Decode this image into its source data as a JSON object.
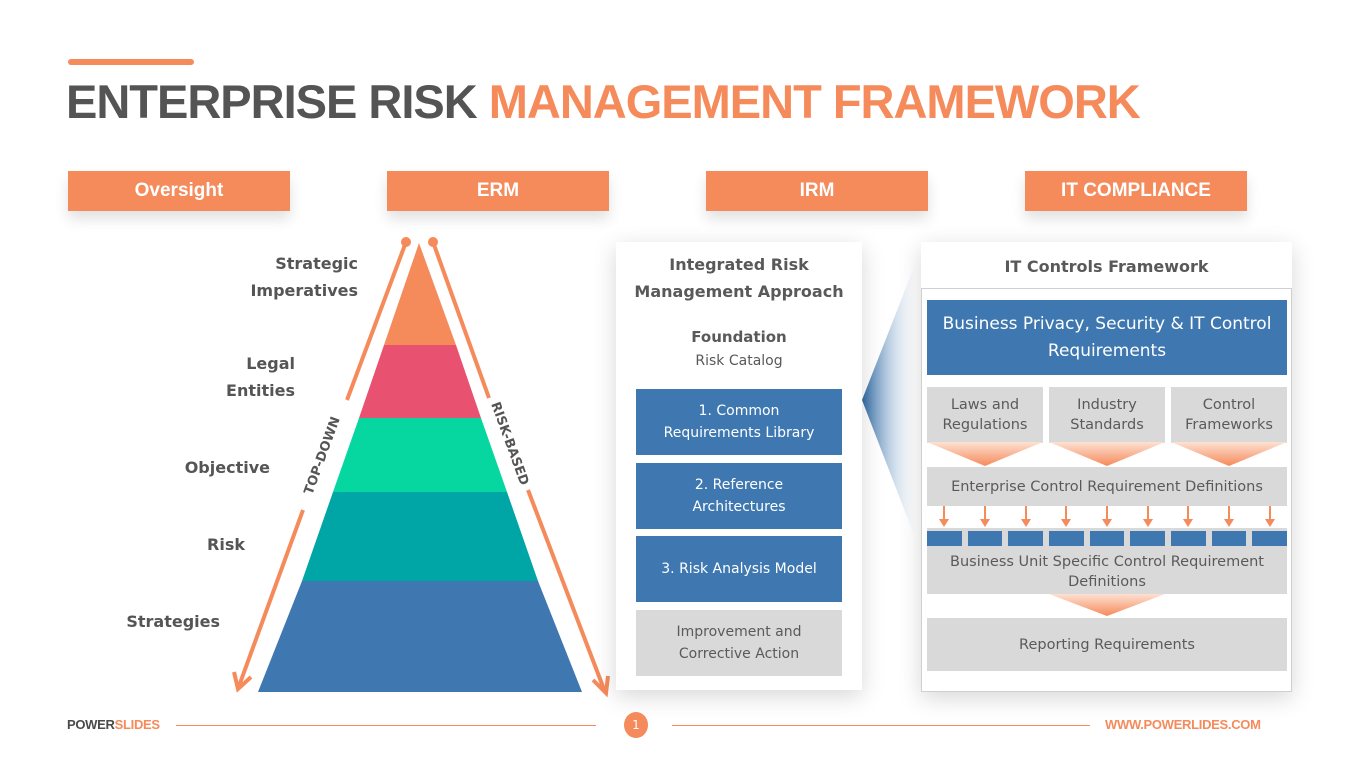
{
  "title": {
    "part1": "ENTERPRISE RISK",
    "part2": "MANAGEMENT FRAMEWORK"
  },
  "categories": [
    "Oversight",
    "ERM",
    "IRM",
    "IT COMPLIANCE"
  ],
  "pyramid": {
    "levels": [
      {
        "label_lines": [
          "Strategic",
          "Imperatives"
        ],
        "color": "#f58a5b"
      },
      {
        "label_lines": [
          "Legal",
          "Entities"
        ],
        "color": "#e85270"
      },
      {
        "label_lines": [
          "Objective"
        ],
        "color": "#06d6a0"
      },
      {
        "label_lines": [
          "Risk"
        ],
        "color": "#00a6a6"
      },
      {
        "label_lines": [
          "Strategies"
        ],
        "color": "#3f78b0"
      }
    ],
    "left_arrow_label": "TOP-DOWN",
    "right_arrow_label": "RISK-BASED",
    "arrow_color": "#f58a5b"
  },
  "irm": {
    "title_line1": "Integrated Risk",
    "title_line2": "Management Approach",
    "foundation": "Foundation",
    "catalog": "Risk Catalog",
    "steps": [
      {
        "line1": "1. Common",
        "line2": "Requirements Library"
      },
      {
        "line1": "2. Reference",
        "line2": "Architectures"
      },
      {
        "line1": "3. Risk Analysis Model",
        "line2": ""
      }
    ],
    "final_line1": "Improvement and",
    "final_line2": "Corrective Action"
  },
  "it": {
    "title": "IT Controls Framework",
    "top_line1": "Business Privacy, Security & IT Control",
    "top_line2": "Requirements",
    "sources": [
      {
        "line1": "Laws and",
        "line2": "Regulations"
      },
      {
        "line1": "Industry",
        "line2": "Standards"
      },
      {
        "line1": "Control",
        "line2": "Frameworks"
      }
    ],
    "enterprise": "Enterprise Control Requirement Definitions",
    "business_unit_line1": "Business Unit Specific Control Requirement",
    "business_unit_line2": "Definitions",
    "reporting": "Reporting Requirements",
    "unit_count": 9
  },
  "footer": {
    "brand_dark": "POWER",
    "brand_orange": "SLIDES",
    "page": "1",
    "url": "WWW.POWERLIDES.COM"
  },
  "colors": {
    "accent": "#f58a5b",
    "blue": "#3f78b0",
    "grey": "#d9d9d9",
    "text_dark": "#545454"
  }
}
